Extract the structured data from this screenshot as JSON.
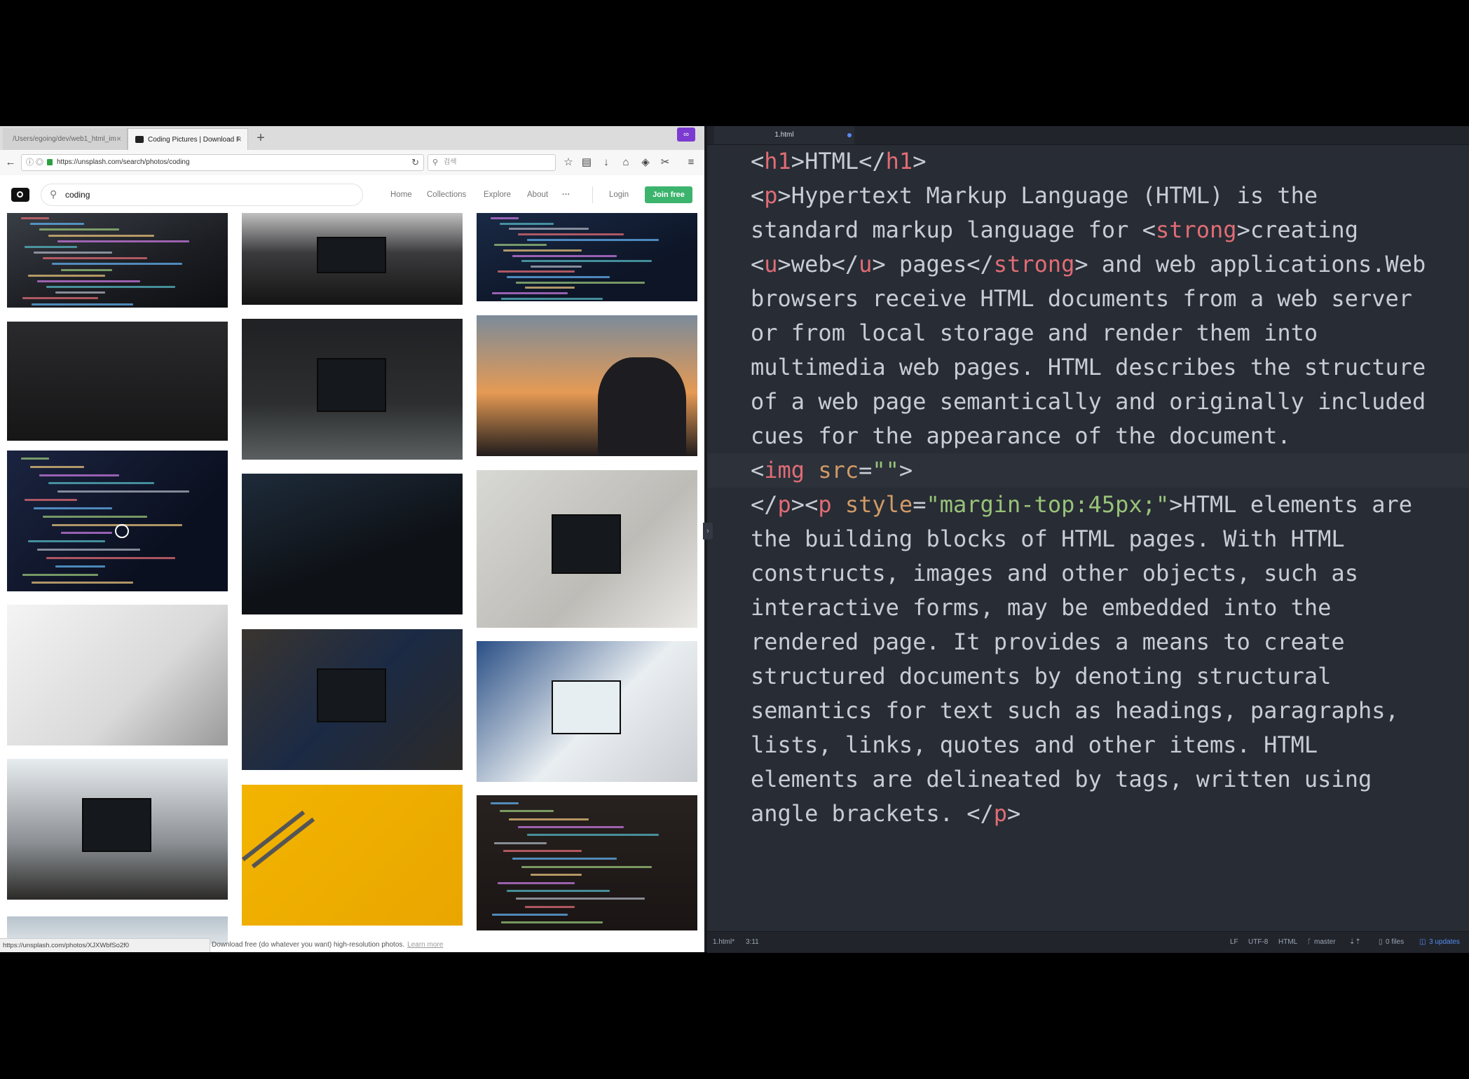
{
  "browser": {
    "tabs": [
      {
        "label": "/Users/egoing/dev/web1_html_im"
      },
      {
        "label": "Coding Pictures | Download F"
      }
    ],
    "new_tab": "+",
    "ext_badge": "∞",
    "url": "https://unsplash.com/search/photos/coding",
    "search_placeholder": "검색",
    "status_url": "https://unsplash.com/photos/XJXWbfSo2f0"
  },
  "unsplash": {
    "search_value": "coding",
    "nav": {
      "home": "Home",
      "collections": "Collections",
      "explore": "Explore",
      "about": "About",
      "more": "···"
    },
    "login": "Login",
    "join": "Join free",
    "footer_text": "Download free (do whatever you want) high-resolution photos.",
    "learn_more": "Learn more"
  },
  "editor": {
    "tab_title": "1.html",
    "code_lines": [
      [
        [
          "tg-p",
          "<"
        ],
        [
          "tg",
          "h1"
        ],
        [
          "pn",
          ">HTML</"
        ],
        [
          "tg",
          "h1"
        ],
        [
          "pn",
          ">"
        ]
      ],
      [
        [
          "pn",
          "<"
        ],
        [
          "tg",
          "p"
        ],
        [
          "pn",
          ">Hypertext Markup Language (HTML) is the"
        ]
      ],
      [
        [
          "pn",
          "standard markup language for <"
        ],
        [
          "tg",
          "strong"
        ],
        [
          "pn",
          ">creating"
        ]
      ],
      [
        [
          "pn",
          "<"
        ],
        [
          "tg",
          "u"
        ],
        [
          "pn",
          ">web</"
        ],
        [
          "tg",
          "u"
        ],
        [
          "pn",
          "> pages</"
        ],
        [
          "tg",
          "strong"
        ],
        [
          "pn",
          "> and web applications.Web"
        ]
      ],
      [
        [
          "pn",
          "browsers receive HTML documents from a web server"
        ]
      ],
      [
        [
          "pn",
          "or from local storage and render them into"
        ]
      ],
      [
        [
          "pn",
          "multimedia web pages. HTML describes the structure"
        ]
      ],
      [
        [
          "pn",
          "of a web page semantically and originally included"
        ]
      ],
      [
        [
          "pn",
          "cues for the appearance of the document."
        ]
      ],
      [
        [
          "pn",
          "<"
        ],
        [
          "tg",
          "img"
        ],
        [
          "pn",
          " "
        ],
        [
          "at",
          "src"
        ],
        [
          "pn",
          "="
        ],
        [
          "st",
          "\"\""
        ],
        [
          "pn",
          ">"
        ]
      ],
      [
        [
          "pn",
          "</"
        ],
        [
          "tg",
          "p"
        ],
        [
          "pn",
          "><"
        ],
        [
          "tg",
          "p"
        ],
        [
          "pn",
          " "
        ],
        [
          "at",
          "style"
        ],
        [
          "pn",
          "="
        ],
        [
          "st",
          "\"margin-top:45px;\""
        ],
        [
          "pn",
          ">HTML elements are"
        ]
      ],
      [
        [
          "pn",
          "the building blocks of HTML pages. With HTML"
        ]
      ],
      [
        [
          "pn",
          "constructs, images and other objects, such as"
        ]
      ],
      [
        [
          "pn",
          "interactive forms, may be embedded into the"
        ]
      ],
      [
        [
          "pn",
          "rendered page. It provides a means to create"
        ]
      ],
      [
        [
          "pn",
          "structured documents by denoting structural"
        ]
      ],
      [
        [
          "pn",
          "semantics for text such as headings, paragraphs,"
        ]
      ],
      [
        [
          "pn",
          "lists, links, quotes and other items. HTML"
        ]
      ],
      [
        [
          "pn",
          "elements are delineated by tags, written using"
        ]
      ],
      [
        [
          "pn",
          "angle brackets. </"
        ],
        [
          "tg",
          "p"
        ],
        [
          "pn",
          ">"
        ]
      ]
    ],
    "status": {
      "file": "1.html*",
      "cursor": "3:11",
      "line_ending": "LF",
      "encoding": "UTF-8",
      "grammar": "HTML",
      "branch": "master",
      "files": "0 files",
      "updates": "3 updates"
    }
  },
  "colors": {
    "editor_bg": "#282c34",
    "tag": "#e06c75",
    "attr": "#d19a66",
    "string": "#98c379",
    "join_btn": "#3cb46e"
  }
}
